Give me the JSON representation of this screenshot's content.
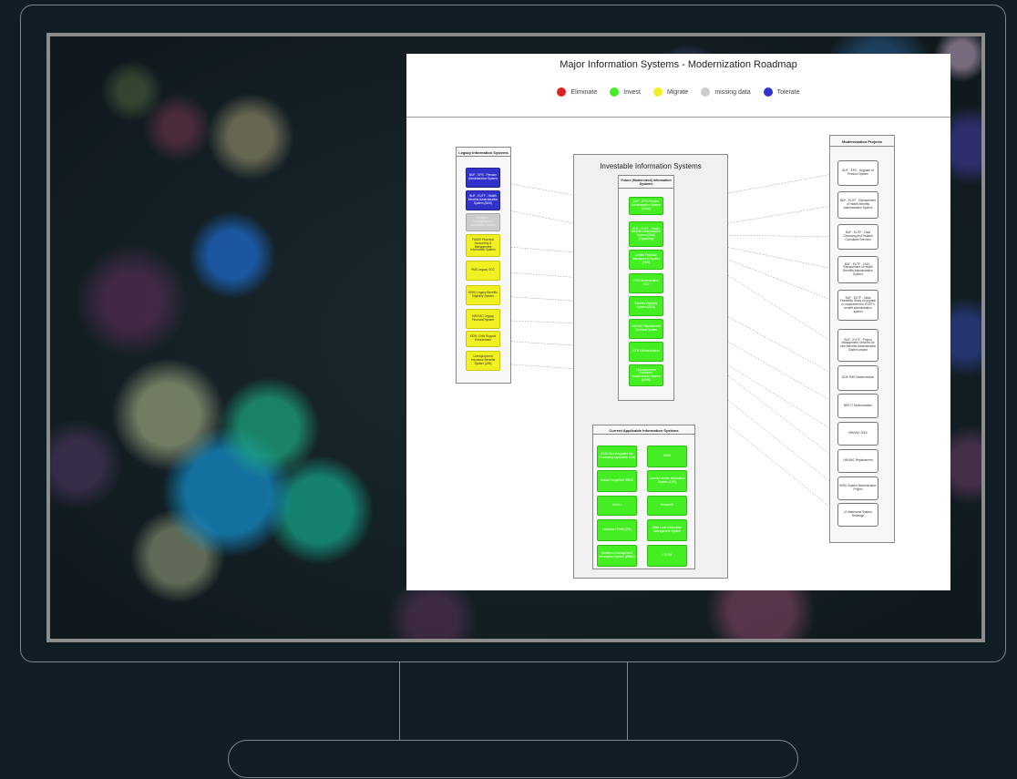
{
  "diagram": {
    "title": "Major Information Systems - Modernization Roadmap",
    "legend": [
      {
        "label": "Eliminate",
        "color": "#dd2222"
      },
      {
        "label": "Invest",
        "color": "#44ee22"
      },
      {
        "label": "Migrate",
        "color": "#f0f022"
      },
      {
        "label": "missing data",
        "color": "#cccccc"
      },
      {
        "label": "Tolerate",
        "color": "#3333cc"
      }
    ],
    "legacy": {
      "header": "Legacy Information Systems",
      "items": [
        "BUF - EPS - Pension Administration System",
        "BUF - EUTF - Health Benefits Administration System (BAS)",
        "Landcare - Unemployment Information System",
        "FAMIS Financial Accounting & Management Information System",
        "FMS Legacy OCC",
        "KEIKI Legacy Benefits Eligibility System",
        "HAVVAC Legacy Financial System",
        "KEIKI Child Support Enforcement",
        "Unemployment Insurance Benefits System (UIB)"
      ]
    },
    "investable": {
      "title": "Investable Information Systems",
      "future": {
        "header": "Future (Modernized) Information Systems",
        "items": [
          "BUF - EPS Pension Administration System (Cloud)",
          "BUF - EUTF - Health Benefits Administration System (BAS) (Upgrading)",
          "Unified Financial Management System (FMS)",
          "FMS Modernization OCC",
          "Benefits Eligibility System (BES)",
          "HAVVAC Replacement Financial System",
          "KEIKI Modernization",
          "Unemployment Insurance Modernization System (UIMS)"
        ]
      },
      "current": {
        "header": "Current Applicable Information Systems",
        "items": [
          "DATA.Gov Integrated Tax Processing Application (ITA)",
          "HIMS",
          "Hawaii PeopleSoft HRMS",
          "Juvenile Justice Information System (JJIS)",
          "KUALI",
          "Kronos/Hr",
          "Hawaiian HRMS (ISE)",
          "State Land Information Management System",
          "Workforce Management Information System (WMIS)",
          "KOLEA"
        ]
      }
    },
    "projects": {
      "header": "Modernization Projects",
      "items": [
        "BUF - EPS - Upgrade of Pension System",
        "BUF - EUTF - Replacement of Health Benefits Administration System",
        "BUF - EUTF - Data Cleansing and Related Consultant Services",
        "BUF - EUTF - IV&V - Replacement of Health Benefits Administration System",
        "BUF - EUTF - Initial Feasibility Study of upgrade or replacement to EUTF's benefit administration system",
        "BUF - EUTF - Project Management Services for new Benefits Administration System project",
        "DOE FMS Modernization",
        "BES IT Modernization",
        "HAVVAC IV&V",
        "HAVVAC Replacement",
        "KEIKI System Modernization Project",
        "UI Mainframe System Redesign"
      ]
    }
  }
}
